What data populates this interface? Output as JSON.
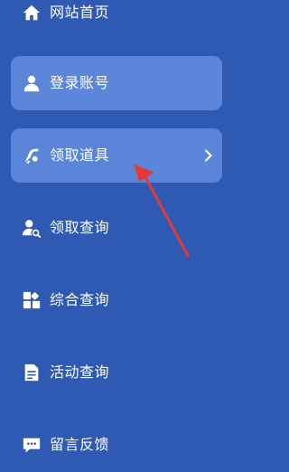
{
  "colors": {
    "background": "#2f5ab4",
    "item_highlight": "#5b86da",
    "text": "#ffffff",
    "annotation_arrow": "#e53935"
  },
  "nav": {
    "items": [
      {
        "label": "网站首页",
        "icon": "home-icon",
        "highlighted": false
      },
      {
        "label": "登录账号",
        "icon": "user-icon",
        "highlighted": true
      },
      {
        "label": "领取道具",
        "icon": "item-tool-icon",
        "highlighted": true,
        "active": true,
        "has_chevron": true
      },
      {
        "label": "领取查询",
        "icon": "user-search-icon",
        "highlighted": false
      },
      {
        "label": "综合查询",
        "icon": "grid-icon",
        "highlighted": false
      },
      {
        "label": "活动查询",
        "icon": "document-icon",
        "highlighted": false
      },
      {
        "label": "留言反馈",
        "icon": "message-icon",
        "highlighted": false
      }
    ]
  },
  "annotation": {
    "icon": "red-arrow-pointing-to-active-item"
  }
}
